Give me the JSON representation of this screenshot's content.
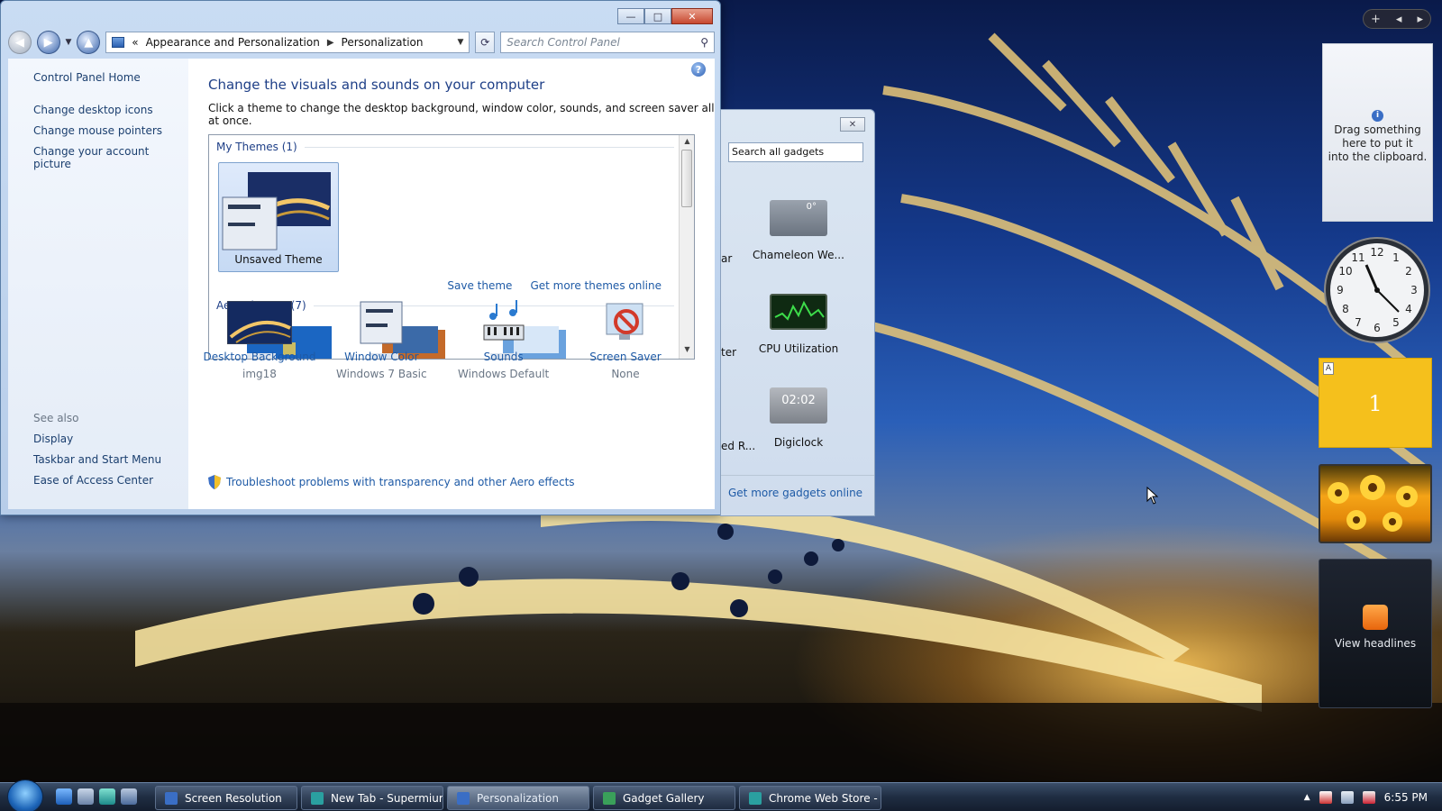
{
  "window": {
    "title_buttons": {
      "minimize": "—",
      "maximize": "□",
      "close": "✕"
    },
    "breadcrumb": {
      "root": "«",
      "item1": "Appearance and Personalization",
      "item2": "Personalization"
    },
    "search_placeholder": "Search Control Panel",
    "left_nav": {
      "home": "Control Panel Home",
      "items": [
        "Change desktop icons",
        "Change mouse pointers",
        "Change your account picture"
      ],
      "see_also_heading": "See also",
      "see_also": [
        "Display",
        "Taskbar and Start Menu",
        "Ease of Access Center"
      ]
    },
    "heading": "Change the visuals and sounds on your computer",
    "subheading": "Click a theme to change the desktop background, window color, sounds, and screen saver all at once.",
    "my_themes_label": "My Themes (1)",
    "unsaved_theme": "Unsaved Theme",
    "save_theme": "Save theme",
    "get_more_themes": "Get more themes online",
    "aero_themes_label": "Aero Themes (7)",
    "options": [
      {
        "title": "Desktop Background",
        "value": "img18"
      },
      {
        "title": "Window Color",
        "value": "Windows 7 Basic"
      },
      {
        "title": "Sounds",
        "value": "Windows Default"
      },
      {
        "title": "Screen Saver",
        "value": "None"
      }
    ],
    "troubleshoot": "Troubleshoot problems with transparency and other Aero effects"
  },
  "gadget_gallery": {
    "close": "✕",
    "search_value": "Search all gadgets",
    "items": [
      {
        "label": "Chameleon We...",
        "partial": "ar"
      },
      {
        "label": "CPU Utilization",
        "partial": "ter"
      },
      {
        "label": "Digiclock",
        "partial": "ed R..."
      }
    ],
    "chameleon_temp": "0°",
    "digiclock_time": "02:02",
    "more_link": "Get more gadgets online"
  },
  "sidebar": {
    "controls": {
      "add": "+",
      "prev": "◂",
      "next": "▸"
    },
    "clipboard_info": "i",
    "clipboard_text_1": "Drag something",
    "clipboard_text_2": "here to put it",
    "clipboard_text_3": "into the clipboard.",
    "clock_numbers": [
      "12",
      "1",
      "2",
      "3",
      "4",
      "5",
      "6",
      "7",
      "8",
      "9",
      "10",
      "11"
    ],
    "note_tab": "A",
    "note_text": "1",
    "feed_label": "View headlines"
  },
  "taskbar": {
    "buttons": [
      {
        "label": "Screen Resolution",
        "color": "#3a6ec5"
      },
      {
        "label": "New Tab - Supermium",
        "color": "#2aa0a0"
      },
      {
        "label": "Personalization",
        "color": "#3a6ec5"
      },
      {
        "label": "Gadget Gallery",
        "color": "#3aa05a"
      },
      {
        "label": "Chrome Web Store - ...",
        "color": "#2aa0a0"
      }
    ],
    "clock": "6:55 PM"
  },
  "colors": {
    "link": "#1e5aa6",
    "heading": "#1e3f87",
    "note": "#f5c01c"
  }
}
